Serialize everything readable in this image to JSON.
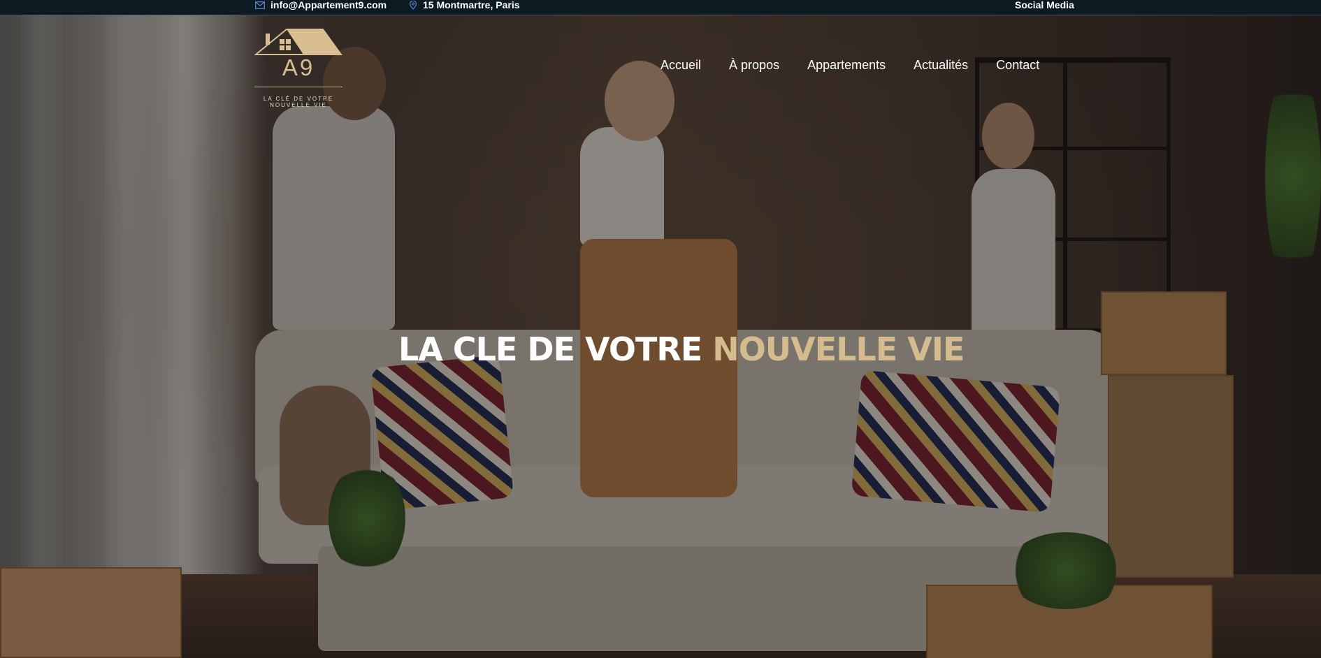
{
  "topbar": {
    "email": "info@Appartement9.com",
    "address": "15 Montmartre, Paris",
    "social": "Social Media",
    "email_icon": "mail-icon",
    "address_icon": "map-pin-icon"
  },
  "logo": {
    "letters": "A9",
    "tagline_line1": "LA CLÉ DE VOTRE",
    "tagline_line2": "NOUVELLE VIE",
    "icon": "house-roof-icon",
    "color": "#d7bd8f"
  },
  "nav": {
    "items": [
      {
        "label": "Accueil"
      },
      {
        "label": "À propos"
      },
      {
        "label": "Appartements"
      },
      {
        "label": "Actualités"
      },
      {
        "label": "Contact"
      }
    ]
  },
  "hero": {
    "title_white": "LA CLE DE VOTRE",
    "title_gold": "NOUVELLE VIE",
    "title_gold_color": "#d4bc8e",
    "background": "family-moving-into-apartment-photo"
  },
  "colors": {
    "topbar_bg": "#0c1b22",
    "accent_gold": "#d4bc8e",
    "text": "#ffffff"
  }
}
